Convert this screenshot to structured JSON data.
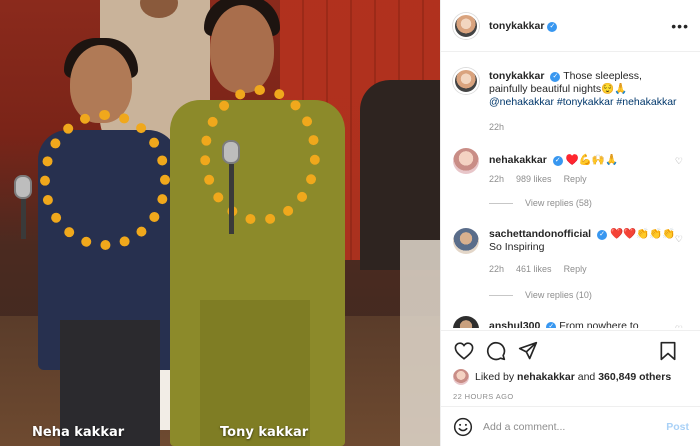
{
  "photo": {
    "caption_left": "Neha kakkar",
    "caption_right": "Tony kakkar"
  },
  "header": {
    "username": "tonykakkar",
    "more_icon": "more-horizontal-icon"
  },
  "post_caption": {
    "username": "tonykakkar",
    "text": "Those sleepless, painfully beautiful nights😌🙏",
    "mention": "@nehakakkar",
    "hashtags": "#tonykakkar #nehakakkar",
    "age": "22h"
  },
  "comments": [
    {
      "username": "nehakakkar",
      "text": "♥️💪🙌🙏",
      "age": "22h",
      "likes": "989 likes",
      "reply": "Reply",
      "view_replies": "View replies (58)"
    },
    {
      "username": "sachettandonofficial",
      "text": "❤️❤️👏👏👏 So Inspiring",
      "age": "22h",
      "likes": "461 likes",
      "reply": "Reply",
      "view_replies": "View replies (10)"
    },
    {
      "username": "anshul300",
      "text": "From nowhere to",
      "age": "",
      "likes": "",
      "reply": "",
      "view_replies": ""
    }
  ],
  "actions": {
    "liked_prefix": "Liked by",
    "liked_user": "nehakakkar",
    "liked_and": "and",
    "liked_count": "360,849 others",
    "timestamp": "22 HOURS AGO"
  },
  "add_comment": {
    "placeholder": "Add a comment...",
    "post_label": "Post"
  },
  "colors": {
    "verified": "#3897f0",
    "link": "#00376b",
    "post_disabled": "#a9d1f7"
  }
}
